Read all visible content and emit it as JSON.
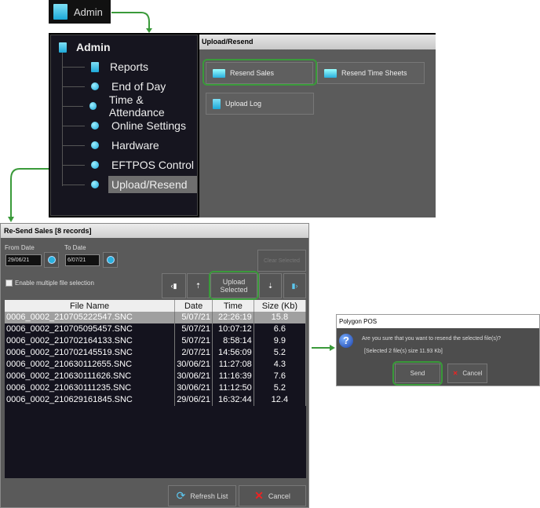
{
  "admin_tile": {
    "label": "Admin"
  },
  "admin_window": {
    "sidebar": {
      "root": "Admin",
      "items": [
        {
          "label": "Reports",
          "icon": "document-icon"
        },
        {
          "label": "End of Day",
          "icon": "dot-icon"
        },
        {
          "label": "Time & Attendance",
          "icon": "dot-icon"
        },
        {
          "label": "Online Settings",
          "icon": "dot-icon"
        },
        {
          "label": "Hardware",
          "icon": "dot-icon"
        },
        {
          "label": "EFTPOS Control",
          "icon": "dot-icon"
        },
        {
          "label": "Upload/Resend",
          "icon": "dot-icon",
          "selected": true
        }
      ]
    },
    "panel": {
      "title": "Upload/Resend",
      "resend_sales": "Resend Sales",
      "resend_time_sheets": "Resend Time Sheets",
      "upload_log": "Upload Log"
    }
  },
  "resend_window": {
    "title": "Re-Send Sales [8 records]",
    "from_label": "From Date",
    "from_value": "29/06/21",
    "to_label": "To Date",
    "to_value": "6/07/21",
    "clear_selected": "Clear Selected",
    "multi_select_label": "Enable multiple file selection",
    "upload_selected": "Upload Selected",
    "columns": [
      "File Name",
      "Date",
      "Time",
      "Size (Kb)"
    ],
    "rows": [
      [
        "0006_0002_210705222547.SNC",
        "5/07/21",
        "22:26:19",
        "15.8"
      ],
      [
        "0006_0002_210705095457.SNC",
        "5/07/21",
        "10:07:12",
        "6.6"
      ],
      [
        "0006_0002_210702164133.SNC",
        "5/07/21",
        "8:58:14",
        "9.9"
      ],
      [
        "0006_0002_210702145519.SNC",
        "2/07/21",
        "14:56:09",
        "5.2"
      ],
      [
        "0006_0002_210630112655.SNC",
        "30/06/21",
        "11:27:08",
        "4.3"
      ],
      [
        "0006_0002_210630111626.SNC",
        "30/06/21",
        "11:16:39",
        "7.6"
      ],
      [
        "0006_0002_210630111235.SNC",
        "30/06/21",
        "11:12:50",
        "5.2"
      ],
      [
        "0006_0002_210629161845.SNC",
        "29/06/21",
        "16:32:44",
        "12.4"
      ]
    ],
    "refresh": "Refresh List",
    "cancel": "Cancel"
  },
  "dialog": {
    "title": "Polygon POS",
    "message": "Are you sure that you want to resend the selected file(s)?",
    "detail": "[Selected 2 file(s) size 11.93 Kb]",
    "send": "Send",
    "cancel": "Cancel"
  },
  "colors": {
    "highlight": "#3a9a3a",
    "accent": "#1ca8d8"
  }
}
